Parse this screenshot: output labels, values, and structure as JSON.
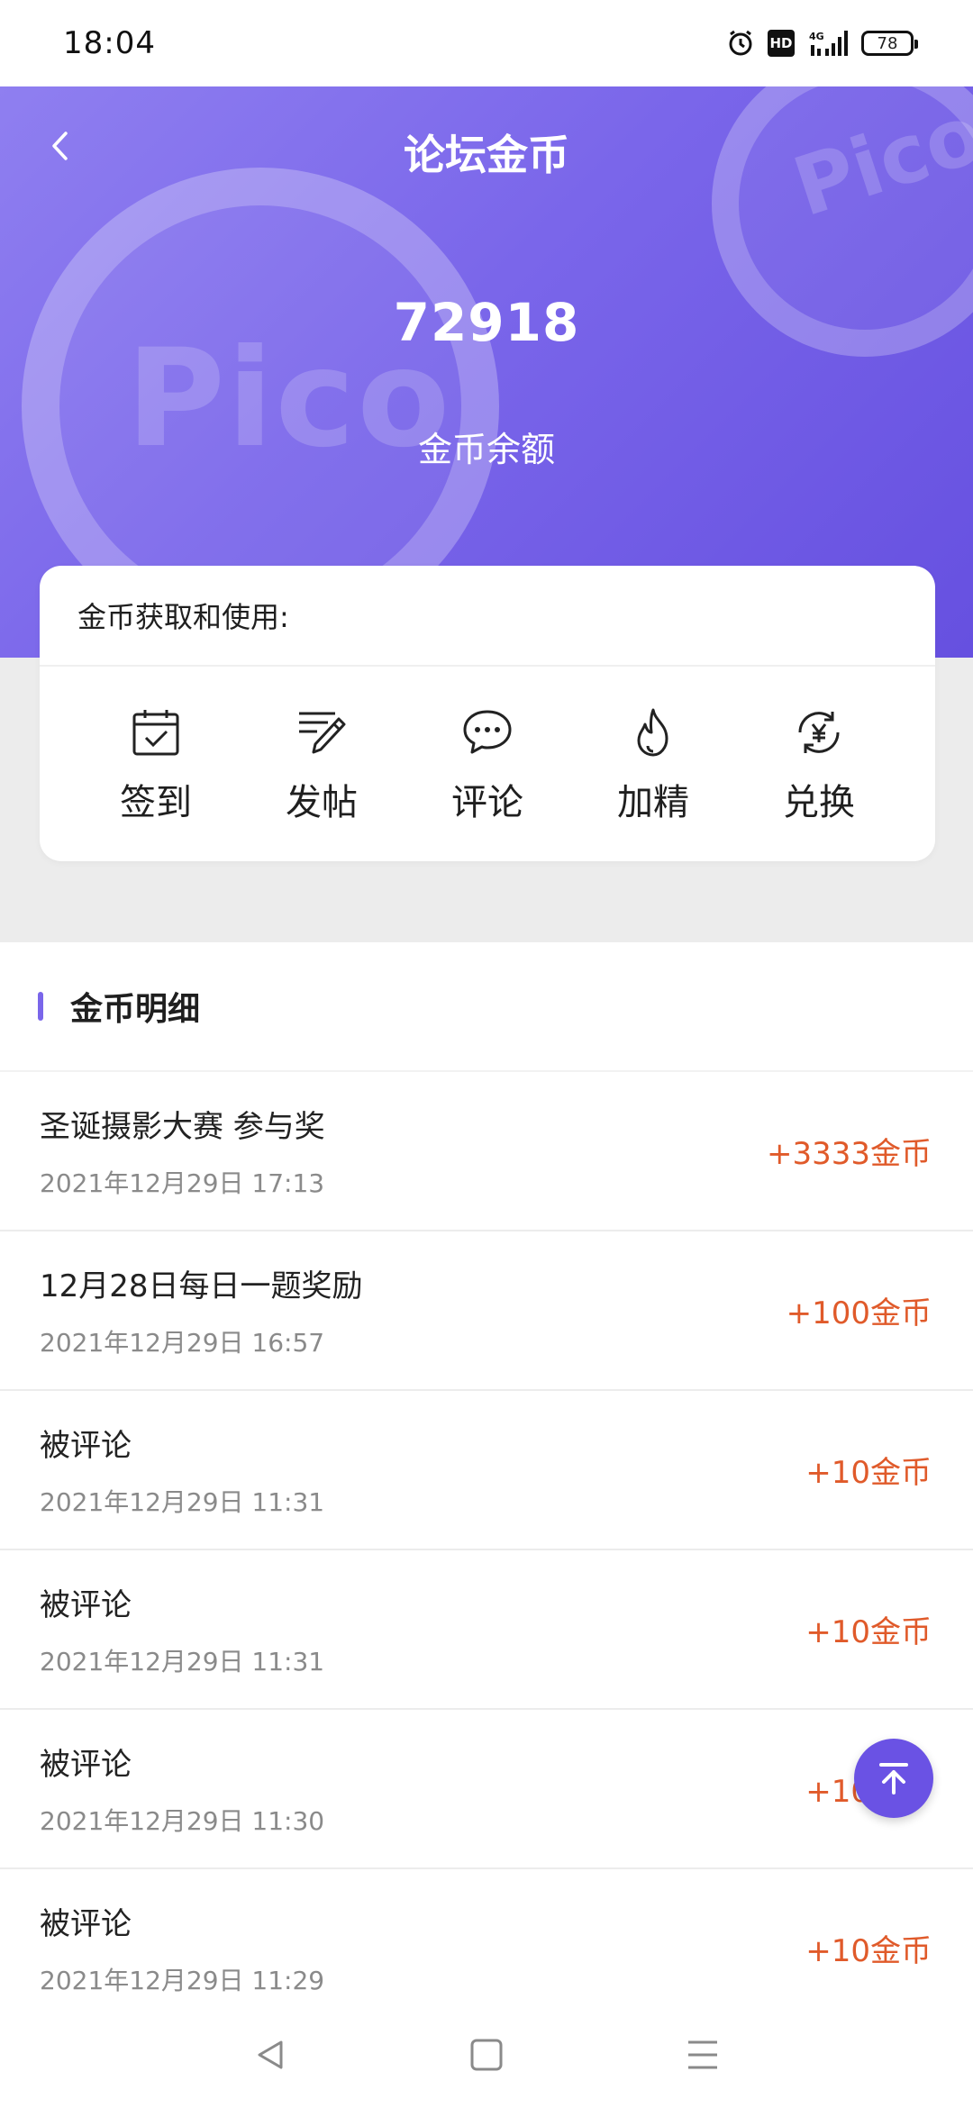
{
  "status_bar": {
    "time": "18:04",
    "network": "4G",
    "hd": "HD",
    "battery": "78"
  },
  "header": {
    "title": "论坛金币",
    "balance": "72918",
    "balance_label": "金币余额",
    "watermark": "Pico"
  },
  "card": {
    "title": "金币获取和使用:",
    "actions": [
      {
        "label": "签到",
        "icon": "calendar-check-icon"
      },
      {
        "label": "发帖",
        "icon": "pen-post-icon"
      },
      {
        "label": "评论",
        "icon": "comment-bubble-icon"
      },
      {
        "label": "加精",
        "icon": "flame-icon"
      },
      {
        "label": "兑换",
        "icon": "yuan-exchange-icon"
      }
    ]
  },
  "section": {
    "title": "金币明细"
  },
  "records": [
    {
      "title": "圣诞摄影大赛 参与奖",
      "time": "2021年12月29日 17:13",
      "amount": "+3333金币"
    },
    {
      "title": "12月28日每日一题奖励",
      "time": "2021年12月29日 16:57",
      "amount": "+100金币"
    },
    {
      "title": "被评论",
      "time": "2021年12月29日 11:31",
      "amount": "+10金币"
    },
    {
      "title": "被评论",
      "time": "2021年12月29日 11:31",
      "amount": "+10金币"
    },
    {
      "title": "被评论",
      "time": "2021年12月29日 11:30",
      "amount": "+10金币"
    },
    {
      "title": "被评论",
      "time": "2021年12月29日 11:29",
      "amount": "+10金币"
    }
  ],
  "colors": {
    "accent": "#7a66ea",
    "amount": "#e05a2a"
  }
}
